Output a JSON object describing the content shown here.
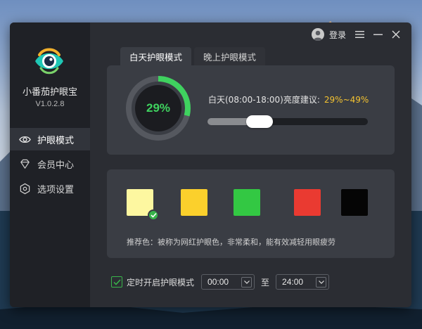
{
  "app": {
    "name": "小番茄护眼宝",
    "version": "V1.0.2.8"
  },
  "topbar": {
    "login_label": "登录"
  },
  "sidebar": {
    "items": [
      {
        "label": "护眼模式",
        "icon": "eye-icon",
        "active": true
      },
      {
        "label": "会员中心",
        "icon": "diamond-icon",
        "active": false
      },
      {
        "label": "选项设置",
        "icon": "settings-icon",
        "active": false
      }
    ]
  },
  "tabs": [
    {
      "label": "白天护眼模式",
      "active": true
    },
    {
      "label": "晚上护眼模式",
      "active": false
    }
  ],
  "brightness": {
    "percent_label": "29%",
    "percent": 29,
    "hint_label": "白天(08:00-18:00)亮度建议:",
    "range_label": "29%~49%",
    "slider_value": 0.29
  },
  "colors": {
    "swatches": [
      {
        "name": "light-yellow",
        "hex": "#fdf7a0",
        "selected": true
      },
      {
        "name": "yellow",
        "hex": "#fbd02c",
        "selected": false
      },
      {
        "name": "green",
        "hex": "#33c843",
        "selected": false
      },
      {
        "name": "red",
        "hex": "#ea3a31",
        "selected": false
      },
      {
        "name": "black",
        "hex": "#050505",
        "selected": false
      }
    ],
    "recommendation": "推荐色：被称为网红护眼色，非常柔和，能有效减轻用眼疲劳"
  },
  "timer": {
    "checked": true,
    "label": "定时开启护眼模式",
    "start": "00:00",
    "to_label": "至",
    "end": "24:00"
  },
  "accent": {
    "green": "#3fd25f",
    "gold": "#f4c330"
  }
}
